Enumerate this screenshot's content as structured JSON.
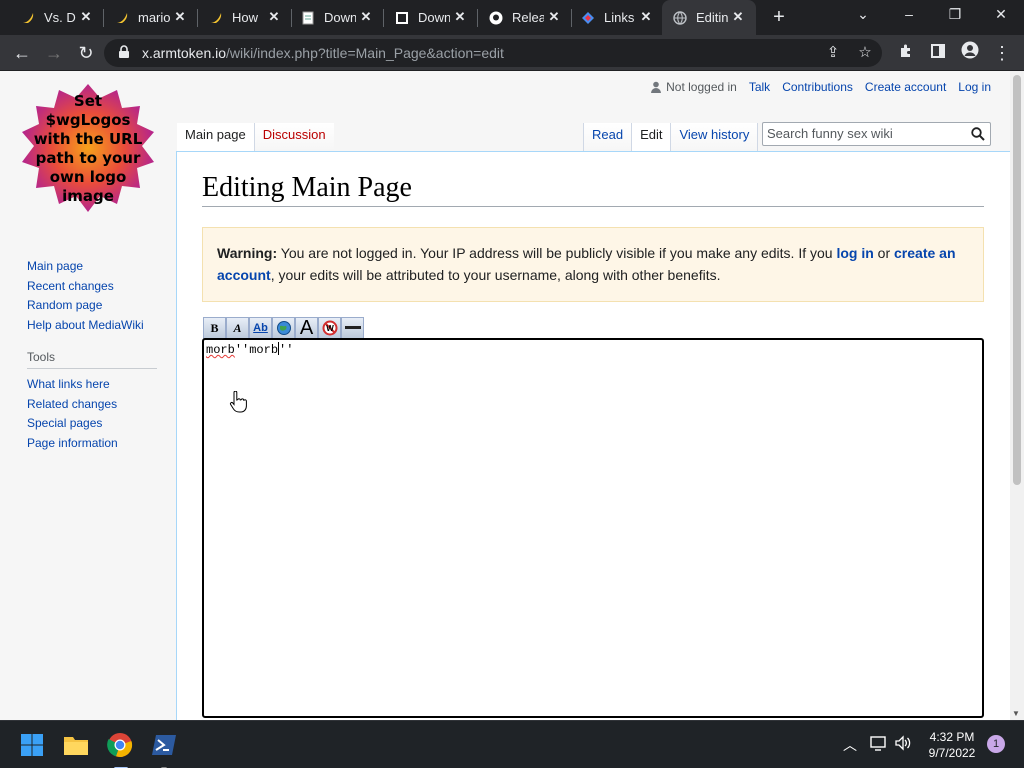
{
  "browser": {
    "tabs": [
      {
        "title": "Vs. Da",
        "icon": "banana-icon"
      },
      {
        "title": "mario",
        "icon": "banana-icon"
      },
      {
        "title": "How",
        "icon": "banana-icon"
      },
      {
        "title": "Down",
        "icon": "notepad-icon"
      },
      {
        "title": "Down",
        "icon": "download-file-icon"
      },
      {
        "title": "Relea",
        "icon": "github-icon"
      },
      {
        "title": "Links",
        "icon": "diamond-icon"
      },
      {
        "title": "Editin",
        "icon": "globe-icon"
      }
    ],
    "address": {
      "host": "x.armtoken.io",
      "path": "/wiki/index.php?title=Main_Page&action=edit"
    }
  },
  "wiki": {
    "logo_text": [
      "Set",
      "$wgLogos",
      "with the URL",
      "path to your",
      "own logo",
      "image"
    ],
    "personal": {
      "status": "Not logged in",
      "talk": "Talk",
      "contributions": "Contributions",
      "create_account": "Create account",
      "log_in": "Log in"
    },
    "tabs": {
      "main_page": "Main page",
      "discussion": "Discussion",
      "read": "Read",
      "edit": "Edit",
      "view_history": "View history"
    },
    "search": {
      "placeholder": "Search funny sex wiki"
    },
    "title": "Editing Main Page",
    "warning": {
      "label": "Warning:",
      "text1": " You are not logged in. Your IP address will be publicly visible if you make any edits. If you ",
      "link1": "log in",
      "text2": " or ",
      "link2": "create an account",
      "text3": ", your edits will be attributed to your username, along with other benefits."
    },
    "editor": {
      "word1": "morb",
      "middle": "''",
      "word2": "morb",
      "trail": "''"
    },
    "nav": {
      "main_page": "Main page",
      "recent_changes": "Recent changes",
      "random_page": "Random page",
      "help": "Help about MediaWiki"
    },
    "tools": {
      "heading": "Tools",
      "what_links_here": "What links here",
      "related_changes": "Related changes",
      "special_pages": "Special pages",
      "page_information": "Page information"
    }
  },
  "taskbar": {
    "time": "4:32 PM",
    "date": "9/7/2022",
    "notifications": "1"
  }
}
